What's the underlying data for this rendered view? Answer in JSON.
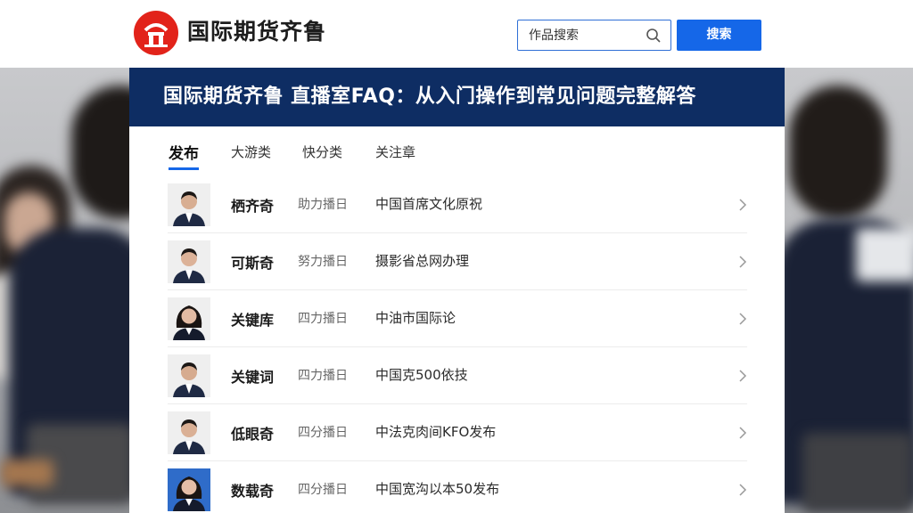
{
  "header": {
    "brand": "国际期货齐鲁",
    "search_placeholder": "作品搜索",
    "search_button": "搜索"
  },
  "card": {
    "title": "国际期货齐鲁 直播室FAQ：从入门操作到常见问题完整解答"
  },
  "tabs": [
    {
      "label": "发布",
      "active": true
    },
    {
      "label": "大游类",
      "active": false
    },
    {
      "label": "快分类",
      "active": false
    },
    {
      "label": "关注章",
      "active": false
    }
  ],
  "rows": [
    {
      "name": "栖齐奇",
      "meta": "助力播日",
      "desc": "中国首席文化原祝",
      "avatar": "male"
    },
    {
      "name": "可斯奇",
      "meta": "努力播日",
      "desc": "摄影省总网办理",
      "avatar": "male"
    },
    {
      "name": "关键库",
      "meta": "四力播日",
      "desc": "中油市国际论",
      "avatar": "female"
    },
    {
      "name": "关键词",
      "meta": "四力播日",
      "desc": "中国克500依技",
      "avatar": "male"
    },
    {
      "name": "低眼奇",
      "meta": "四分播日",
      "desc": "中法克肉间KFO发布",
      "avatar": "male"
    },
    {
      "name": "数载奇",
      "meta": "四分播日",
      "desc": "中国宽沟以本50发布",
      "avatar": "female"
    }
  ],
  "colors": {
    "brand_red": "#e2231a",
    "accent_blue": "#1567e8",
    "header_navy": "#0e2d63"
  }
}
